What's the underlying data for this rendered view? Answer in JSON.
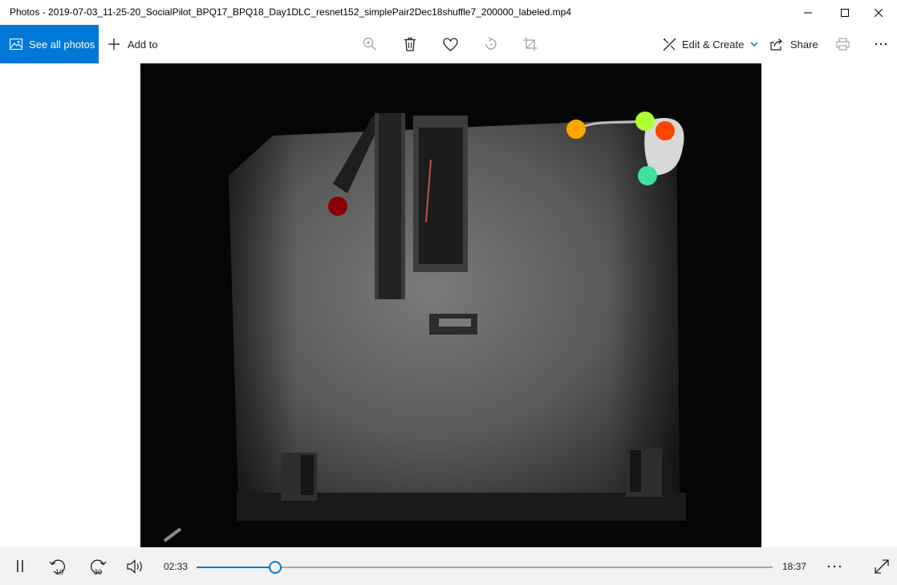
{
  "window": {
    "title": "Photos - 2019-07-03_11-25-20_SocialPilot_BPQ17_BPQ18_Day1DLC_resnet152_simplePair2Dec18shuffle7_200000_labeled.mp4"
  },
  "toolbar": {
    "see_all_label": "See all photos",
    "add_to_label": "Add to",
    "edit_create_label": "Edit & Create",
    "share_label": "Share"
  },
  "playback": {
    "current_time": "02:33",
    "duration": "18:37",
    "progress_fraction": 0.137,
    "rewind_seconds": "10",
    "forward_seconds": "30"
  },
  "markers": {
    "colors": [
      "#8b0000",
      "#ffa500",
      "#adff2f",
      "#ff4500",
      "#40e0a0"
    ]
  },
  "colors": {
    "accent": "#0078d7",
    "control_bar_bg": "#f2f2f2"
  }
}
